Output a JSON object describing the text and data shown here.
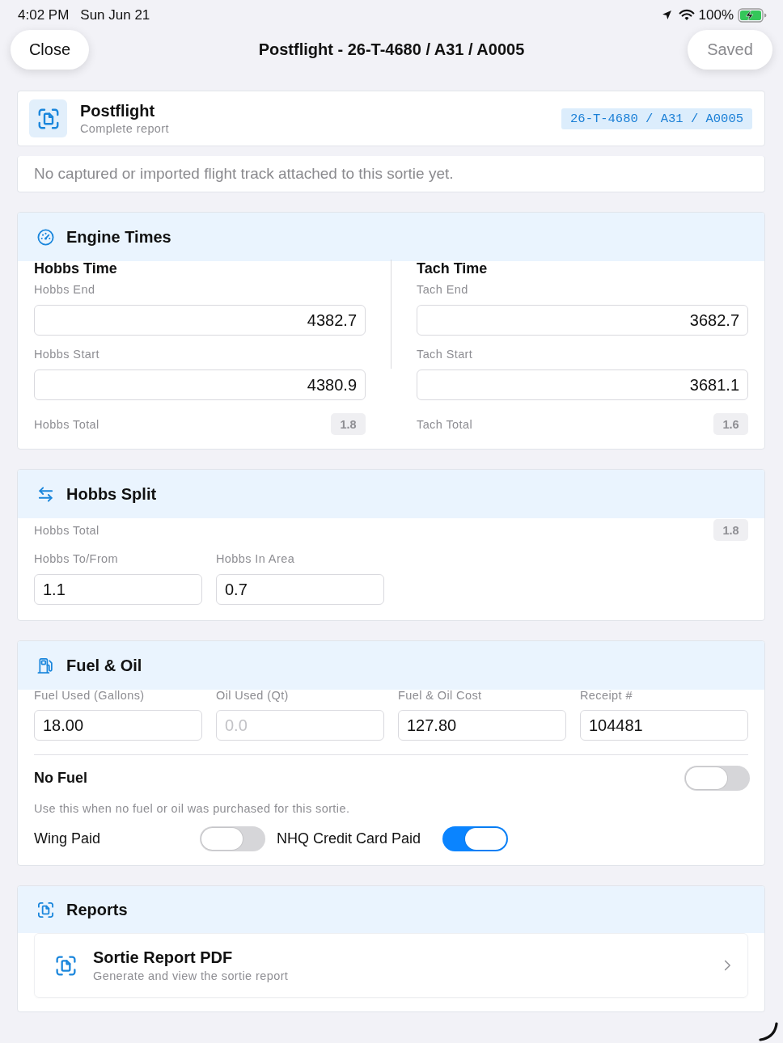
{
  "status_bar": {
    "time": "4:02 PM",
    "date": "Sun Jun 21",
    "battery": "100%",
    "charging": true
  },
  "nav": {
    "close": "Close",
    "title": "Postflight - 26-T-4680 / A31 / A0005",
    "save": {
      "label": "Saved",
      "disabled": true
    }
  },
  "header": {
    "title": "Postflight",
    "subtitle": "Complete report",
    "badge": "26-T-4680 / A31 / A0005"
  },
  "track_note": "No captured or imported flight track attached to this sortie yet.",
  "sections": [
    {
      "kind": "engine_times",
      "title": "Engine Times",
      "columns": [
        {
          "title": "Hobbs Time",
          "fields": [
            {
              "label": "Hobbs End",
              "value": "4382.7"
            },
            {
              "label": "Hobbs Start",
              "value": "4380.9"
            }
          ],
          "total": {
            "label": "Hobbs Total",
            "value": "1.8"
          }
        },
        {
          "title": "Tach Time",
          "fields": [
            {
              "label": "Tach End",
              "value": "3682.7"
            },
            {
              "label": "Tach Start",
              "value": "3681.1"
            }
          ],
          "total": {
            "label": "Tach Total",
            "value": "1.6"
          }
        }
      ]
    },
    {
      "kind": "hobbs_split",
      "title": "Hobbs Split",
      "total": {
        "label": "Hobbs Total",
        "value": "1.8"
      },
      "fields": [
        {
          "label": "Hobbs To/From",
          "value": "1.1"
        },
        {
          "label": "Hobbs In Area",
          "value": "0.7"
        }
      ]
    },
    {
      "kind": "fuel_oil",
      "title": "Fuel & Oil",
      "fields": [
        {
          "label": "Fuel Used (Gallons)",
          "value": "18.00"
        },
        {
          "label": "Oil Used (Qt)",
          "placeholder": "0.0"
        },
        {
          "label": "Fuel & Oil Cost",
          "value": "127.80"
        },
        {
          "label": "Receipt #",
          "value": "104481"
        }
      ],
      "no_fuel": {
        "label": "No Fuel",
        "on": false,
        "description": "Use this when no fuel or oil was purchased for this sortie."
      },
      "payments": [
        {
          "label": "Wing Paid",
          "on": false
        },
        {
          "label": "NHQ Credit Card Paid",
          "on": true
        }
      ]
    },
    {
      "kind": "reports",
      "title": "Reports",
      "items": [
        {
          "title": "Sortie Report PDF",
          "subtitle": "Generate and view the sortie report"
        }
      ]
    }
  ]
}
